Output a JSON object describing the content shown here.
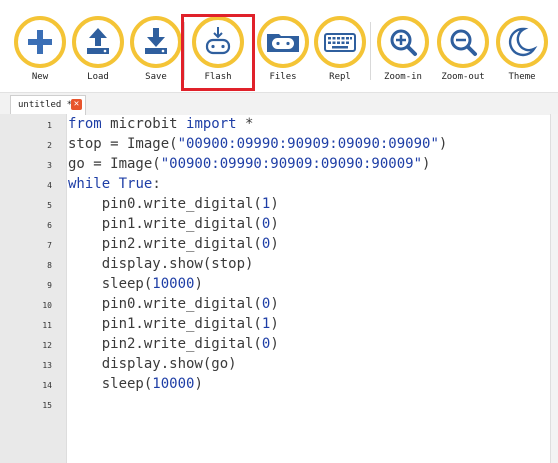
{
  "toolbar": {
    "buttons": [
      {
        "id": "new",
        "label": "New",
        "icon": "plus-icon"
      },
      {
        "id": "load",
        "label": "Load",
        "icon": "upload-icon"
      },
      {
        "id": "save",
        "label": "Save",
        "icon": "download-icon"
      },
      {
        "id": "flash",
        "label": "Flash",
        "icon": "microbit-flash-icon"
      },
      {
        "id": "files",
        "label": "Files",
        "icon": "microbit-icon"
      },
      {
        "id": "repl",
        "label": "Repl",
        "icon": "keyboard-icon"
      },
      {
        "id": "zoom_in",
        "label": "Zoom-in",
        "icon": "zoom-in-icon"
      },
      {
        "id": "zoom_out",
        "label": "Zoom-out",
        "icon": "zoom-out-icon"
      },
      {
        "id": "theme",
        "label": "Theme",
        "icon": "moon-icon"
      }
    ],
    "accent_color": "#f4c436",
    "highlight_color": "#e0212a"
  },
  "tab": {
    "label": "untitled *",
    "close_icon": "close-icon"
  },
  "editor": {
    "line_numbers": [
      "1",
      "2",
      "3",
      "4",
      "5",
      "6",
      "7",
      "8",
      "9",
      "10",
      "11",
      "12",
      "13",
      "14",
      "15"
    ],
    "lines": [
      "from microbit import *",
      "stop = Image(\"00900:09990:90909:09090:09090\")",
      "go = Image(\"00900:09990:90909:09090:90009\")",
      "while True:",
      "    pin0.write_digital(1)",
      "    pin1.write_digital(0)",
      "    pin2.write_digital(0)",
      "    display.show(stop)",
      "    sleep(10000)",
      "    pin0.write_digital(0)",
      "    pin1.write_digital(1)",
      "    pin2.write_digital(0)",
      "    display.show(go)",
      "    sleep(10000)",
      ""
    ]
  }
}
